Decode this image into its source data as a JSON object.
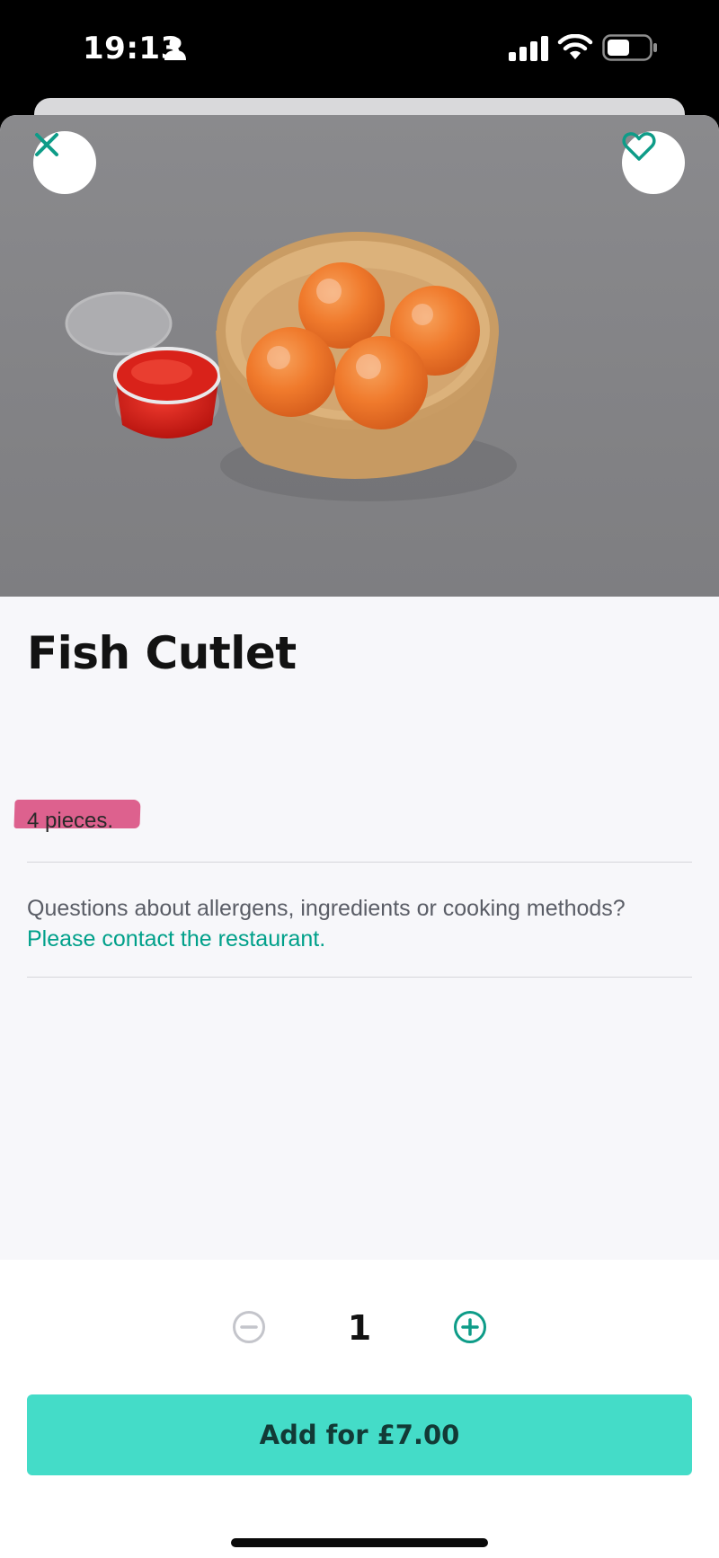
{
  "status_bar": {
    "time": "19:13"
  },
  "item": {
    "title": "Fish Cutlet",
    "description": "4 pieces.",
    "image_alt": "Four breaded fish cutlets in a paper bowl with a tub of red dipping sauce"
  },
  "allergen_info": {
    "question": "Questions about allergens, ingredients or cooking methods?",
    "link": "Please contact the restaurant."
  },
  "quantity": {
    "value": "1"
  },
  "add_button": {
    "label": "Add for £7.00"
  },
  "icons": {
    "close": "close-icon",
    "favorite": "heart-icon",
    "decrement": "minus-circle-icon",
    "increment": "plus-circle-icon"
  },
  "colors": {
    "accent": "#00a08a",
    "button": "#44dcc8",
    "highlight": "#d8477a"
  }
}
